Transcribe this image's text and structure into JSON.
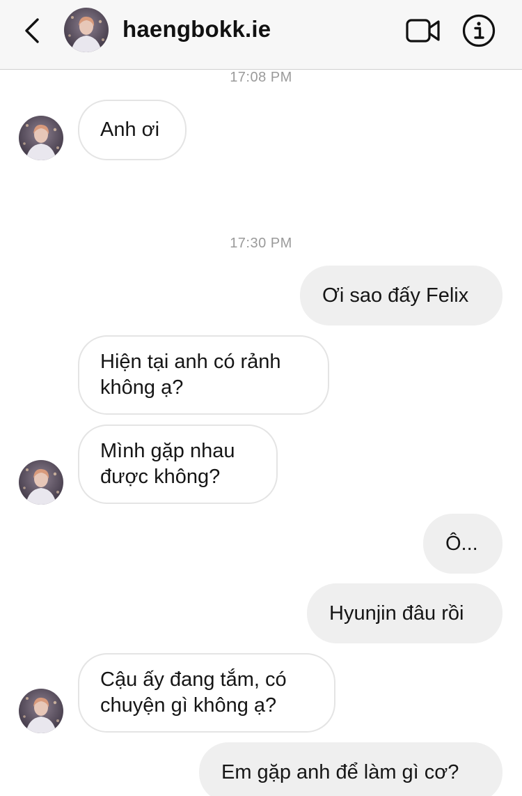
{
  "header": {
    "username": "haengbokk.ie",
    "back_icon": "chevron-left-icon",
    "video_icon": "video-camera-icon",
    "info_icon": "info-icon"
  },
  "thread": {
    "timestamps": [
      "17:08 PM",
      "17:30 PM"
    ],
    "messages": [
      {
        "from": "them",
        "text": "Anh ơi"
      },
      {
        "from": "me",
        "text": "Ơi sao đấy Felix"
      },
      {
        "from": "them",
        "text": "Hiện tại anh có rảnh\nkhông ạ?"
      },
      {
        "from": "them",
        "text": "Mình gặp nhau\nđược không?"
      },
      {
        "from": "me",
        "text": "Ô..."
      },
      {
        "from": "me",
        "text": "Hyunjin đâu rồi"
      },
      {
        "from": "them",
        "text": "Cậu ấy đang tắm, có\nchuyện gì không ạ?"
      },
      {
        "from": "me",
        "text": "Em gặp anh để làm gì cơ?"
      }
    ]
  },
  "colors": {
    "header_bg": "#f7f7f7",
    "incoming_bubble_border": "#e4e4e4",
    "outgoing_bubble_bg": "#efefef",
    "timestamp_text": "#9a9a9a"
  }
}
